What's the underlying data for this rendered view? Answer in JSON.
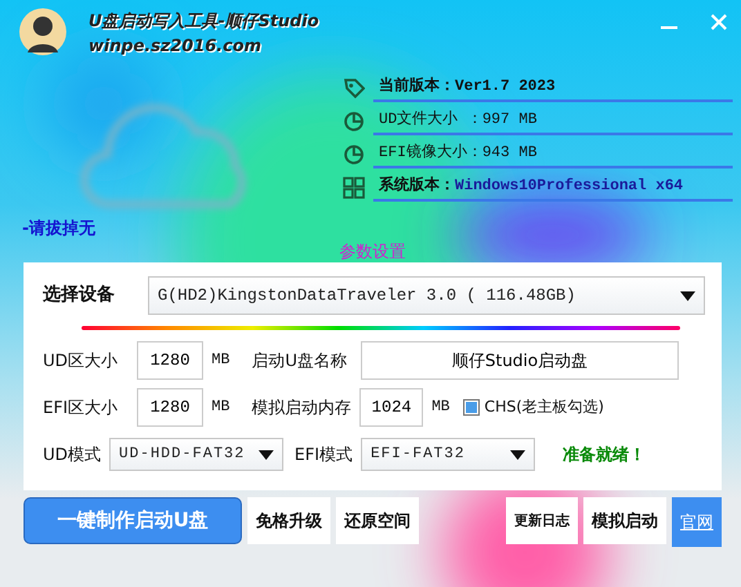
{
  "window": {
    "title": "U盘启动写入工具-顺仔Studio",
    "subtitle": "winpe.sz2016.com"
  },
  "info": [
    {
      "kind": "tag",
      "label": "当前版本：",
      "value": "Ver1.7 2023",
      "emphasis": true
    },
    {
      "kind": "pie",
      "label": "UD文件大小  ：",
      "value": "997 MB",
      "emphasis": false
    },
    {
      "kind": "pie",
      "label": "EFI镜像大小：",
      "value": "943 MB",
      "emphasis": false
    },
    {
      "kind": "windows",
      "label": "系统版本：",
      "value": "Windows10Professional x64",
      "emphasis": true
    }
  ],
  "notice": "-请拔掉无",
  "panel": {
    "title": "参数设置",
    "device": {
      "label": "选择设备",
      "value": "G(HD2)KingstonDataTraveler 3.0 ( 116.48GB)"
    },
    "ud_size": {
      "label": "UD区大小",
      "value": "1280",
      "unit": "MB"
    },
    "boot_name": {
      "label": "启动U盘名称",
      "value": "顺仔Studio启动盘"
    },
    "efi_size": {
      "label": "EFI区大小",
      "value": "1280",
      "unit": "MB"
    },
    "sim_memory": {
      "label": "模拟启动内存",
      "value": "1024",
      "unit": "MB"
    },
    "chs": {
      "label": "CHS(老主板勾选)",
      "checked": true
    },
    "ud_mode": {
      "label": "UD模式",
      "value": "UD-HDD-FAT32"
    },
    "efi_mode": {
      "label": "EFI模式",
      "value": "EFI-FAT32"
    },
    "status": "准备就绪！"
  },
  "buttons_left": [
    {
      "kind": "primary",
      "label": "一键制作启动U盘"
    },
    {
      "kind": "plain",
      "label": "免格升级"
    },
    {
      "kind": "plain",
      "label": "还原空间"
    }
  ],
  "buttons_right": [
    {
      "kind": "small",
      "label": "更新日志"
    },
    {
      "kind": "plain",
      "label": "模拟启动"
    },
    {
      "kind": "link",
      "label": "官网"
    }
  ]
}
